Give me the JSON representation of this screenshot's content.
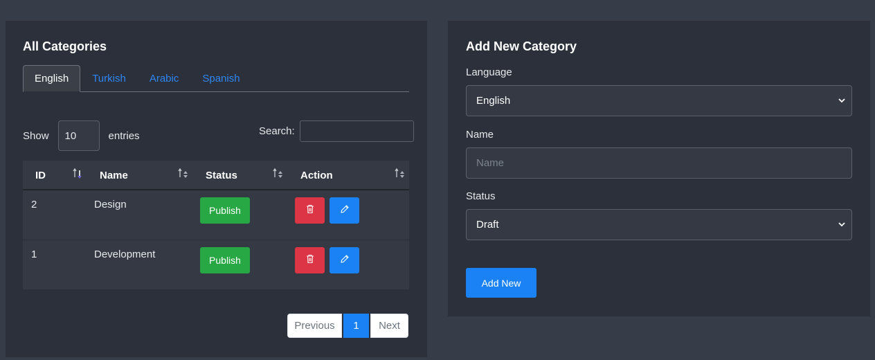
{
  "categories_card": {
    "title": "All Categories",
    "tabs": [
      {
        "label": "English",
        "active": true
      },
      {
        "label": "Turkish",
        "active": false
      },
      {
        "label": "Arabic",
        "active": false
      },
      {
        "label": "Spanish",
        "active": false
      }
    ],
    "show_label": "Show",
    "entries_value": "10",
    "entries_label": "entries",
    "search_label": "Search:",
    "search_value": "",
    "columns": [
      "ID",
      "Name",
      "Status",
      "Action"
    ],
    "rows": [
      {
        "id": "2",
        "name": "Design",
        "status": "Publish"
      },
      {
        "id": "1",
        "name": "Development",
        "status": "Publish"
      }
    ],
    "pagination": {
      "previous": "Previous",
      "current": "1",
      "next": "Next"
    }
  },
  "add_card": {
    "title": "Add New Category",
    "language_label": "Language",
    "language_value": "English",
    "name_label": "Name",
    "name_placeholder": "Name",
    "name_value": "",
    "status_label": "Status",
    "status_value": "Draft",
    "submit_label": "Add New"
  },
  "colors": {
    "page_bg": "#373d48",
    "card_bg": "#2b303a",
    "accent": "#1a82f5",
    "success": "#28a745",
    "danger": "#dc3545",
    "tab_link": "#2f86f6"
  },
  "icons": {
    "delete": "trash-icon",
    "edit": "pencil-icon",
    "select": "chevron-down-icon",
    "sort": "sort-icon"
  }
}
